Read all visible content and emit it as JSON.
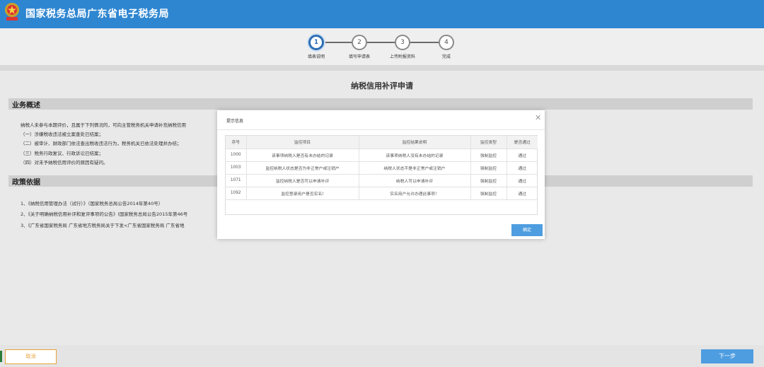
{
  "header": {
    "title": "国家税务总局广东省电子税务局"
  },
  "steps": [
    {
      "num": "1",
      "label": "填表说明",
      "active": true
    },
    {
      "num": "2",
      "label": "填写申请表",
      "active": false
    },
    {
      "num": "3",
      "label": "上传附报资料",
      "active": false
    },
    {
      "num": "4",
      "label": "完成",
      "active": false
    }
  ],
  "main": {
    "page_title": "纳税信用补评申请",
    "overview": {
      "title": "业务概述",
      "lines": [
        "纳税人未参与本期评价，且属于下列情况的，可向主管税务机关申请补充纳税信用",
        "（一）涉嫌税收违法被立案查处已结案；",
        "（二）被审计、财政部门依法查出税收违法行为，税务机关已依法处理并办结；",
        "（三）税务行政复议、行政诉讼已结案；",
        "（四）对未予纳税信用评价的原因有疑问。"
      ]
    },
    "policy": {
      "title": "政策依据",
      "lines": [
        "1、《纳税信用管理办法（试行）》（国家税务总局公告2014年第40号）",
        "2、《关于明确纳税信用补评和复评事项的公告》(国家税务总局公告2015年第46号",
        "3、《广东省国家税务局 广东省地方税务局关于下发<广东省国家税务局 广东省地"
      ]
    }
  },
  "footer": {
    "cancel_label": "取消",
    "next_label": "下一步"
  },
  "modal": {
    "title": "提示信息",
    "close_symbol": "✕",
    "columns": [
      "序号",
      "监控项目",
      "监控结果说明",
      "监控类型",
      "是否通过"
    ],
    "rows": [
      [
        "1000",
        "该事项纳税人是否有未办结的记录",
        "该事项纳税人没有未办结的记录",
        "强制监控",
        "通过"
      ],
      [
        "1003",
        "监控纳税人状态是否为非正常户或注销户",
        "纳税人状态不是非正常户或注销户",
        "强制监控",
        "通过"
      ],
      [
        "1071",
        "监控纳税人是否可以申请补评",
        "纳税人可以申请补评",
        "强制监控",
        "通过"
      ],
      [
        "1092",
        "监控登录用户是否实名!",
        "实名用户允许办理此事项！",
        "强制监控",
        "通过"
      ]
    ],
    "confirm_label": "确定"
  },
  "colors": {
    "header_bg": "#2e86d1",
    "active_step": "#2e6fb5",
    "primary_button": "#4e9de0",
    "cancel_border": "#e6a23c"
  }
}
